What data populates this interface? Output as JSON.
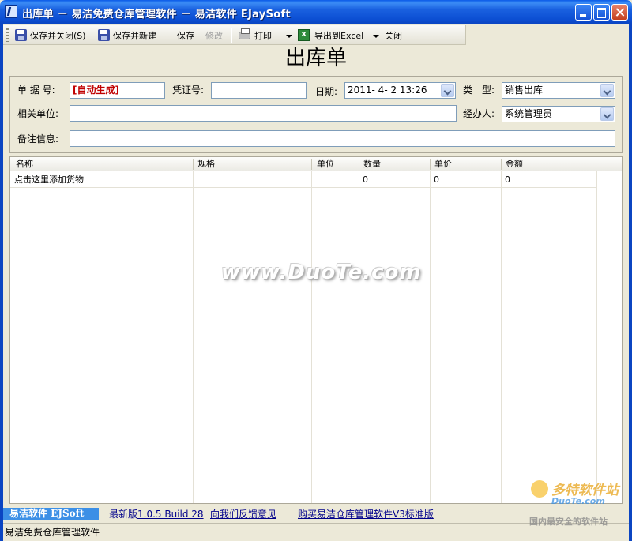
{
  "window": {
    "title": "出库单 － 易洁免费仓库管理软件 － 易洁软件 EJaySoft"
  },
  "toolbar": {
    "save_close": "保存并关闭(S)",
    "save_new": "保存并新建",
    "save": "保存",
    "edit": "修改",
    "print": "打印",
    "export": "导出到Excel",
    "close": "关闭"
  },
  "form": {
    "heading": "出库单",
    "doc_no_label": "单 据 号:",
    "doc_no_value": "[自动生成]",
    "voucher_label": "凭证号:",
    "voucher_value": "",
    "date_label": "日期:",
    "date_value": "2011- 4- 2 13:26",
    "type_label": "类　型:",
    "type_value": "销售出库",
    "unit_label": "相关单位:",
    "unit_value": "",
    "handler_label": "经办人:",
    "handler_value": "系统管理员",
    "note_label": "备注信息:",
    "note_value": ""
  },
  "grid": {
    "columns": [
      "名称",
      "规格",
      "单位",
      "数量",
      "单价",
      "金额"
    ],
    "rows": [
      {
        "name": "点击这里添加货物",
        "spec": "",
        "unit": "",
        "qty": "0",
        "price": "0",
        "amount": "0"
      }
    ]
  },
  "watermark": "www.DuoTe.com",
  "footer": {
    "brand": "易洁软件 EJSoft",
    "latest_prefix": "最新版",
    "latest_version": "1.0.5 Build 28",
    "feedback": "向我们反馈意见",
    "buy": "购买易洁仓库管理软件V3标准版"
  },
  "status": {
    "text": "易洁免费仓库管理软件"
  },
  "corner_logo": {
    "main": "多特软件站",
    "site": "DuoTe.com",
    "slogan": "国内最安全的软件站"
  }
}
